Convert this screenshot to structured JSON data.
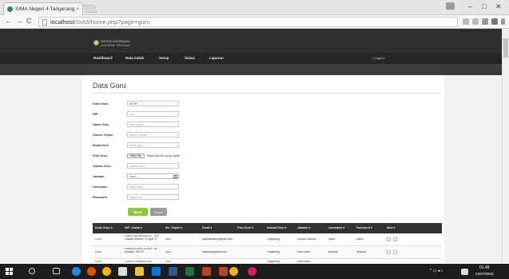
{
  "browser": {
    "tab_title": "SIMA Negeri 4 Tangerang",
    "tab_close": "×",
    "url_host": "localhost",
    "url_path": "/SIAS/home.php?page=guru",
    "back": "←",
    "forward": "→",
    "reload": "C",
    "minimize": "–",
    "maximize": "□",
    "close": "✕"
  },
  "brand": {
    "line1": "SISTEM INFORMASI",
    "line2": "AKADEMIK SEKOLAH"
  },
  "menu": {
    "items": [
      "Dashboard",
      "Data Induk",
      "Setup",
      "Siswa",
      "Laporan"
    ],
    "logout": "• Logout"
  },
  "page": {
    "title": "Data Guru"
  },
  "form": {
    "kode_label": "Kode Guru",
    "kode_value": "G0T8",
    "nip_label": "NIP",
    "nip_placeholder": "nip",
    "nama_label": "Nama Guru",
    "nama_placeholder": "nama guru",
    "telp_label": "Nomor Telpon",
    "telp_placeholder": "nomor telpon",
    "email_label": "Email Guru",
    "email_placeholder": "email guru",
    "foto_label": "Foto Guru",
    "foto_button": "Pilih File",
    "foto_status": "Tidak ada file yang dipilih",
    "alamat_label": "Alamat Guru",
    "alamat_placeholder": "alamat guru",
    "jabatan_label": "Jabatan",
    "jabatan_value": "Guru",
    "username_label": "Username",
    "username_placeholder": "username",
    "password_label": "Password",
    "password_placeholder": "password",
    "save_button": "Save",
    "reset_button": "Reset"
  },
  "table": {
    "headers": [
      "Kode Guru ▾",
      "NIP - Nama ▾",
      "No. Telpon ▾",
      "Email ▾",
      "Foto Guru ▾",
      "Alamat Guru ▾",
      "Jabatan ▾",
      "Username ▾",
      "Password ▾",
      "Aksi ▾"
    ],
    "rows": [
      {
        "kode": "G001",
        "nip_nama": "198907081982032010 - Drs. Juanda Siabetz, S.Ag,M.Si",
        "telp": "0812",
        "email": "juandasiabet@gmail.com",
        "foto": "",
        "alamat": "Tangerang",
        "jabatan": "Kepala Sekolah",
        "username": "juana",
        "password": "juana"
      },
      {
        "kode": "G002",
        "nip_nama": "198304121997032008 - Hj. Isnaeda, SE.Pd",
        "telp": "0812",
        "email": "isnaeda@gmail.com",
        "foto": "",
        "alamat": "Tangerang",
        "jabatan": "Wali Kelas",
        "username": "isnaeda",
        "password": "isnaeda"
      },
      {
        "kode": "G003",
        "nip_nama": "198901211985022004",
        "telp": "0812",
        "email": "",
        "foto": "",
        "alamat": "Tangerang",
        "jabatan": "Wali Kelas",
        "username": "",
        "password": ""
      }
    ]
  },
  "taskbar": {
    "time": "01.49",
    "date": "24/07/2016"
  }
}
